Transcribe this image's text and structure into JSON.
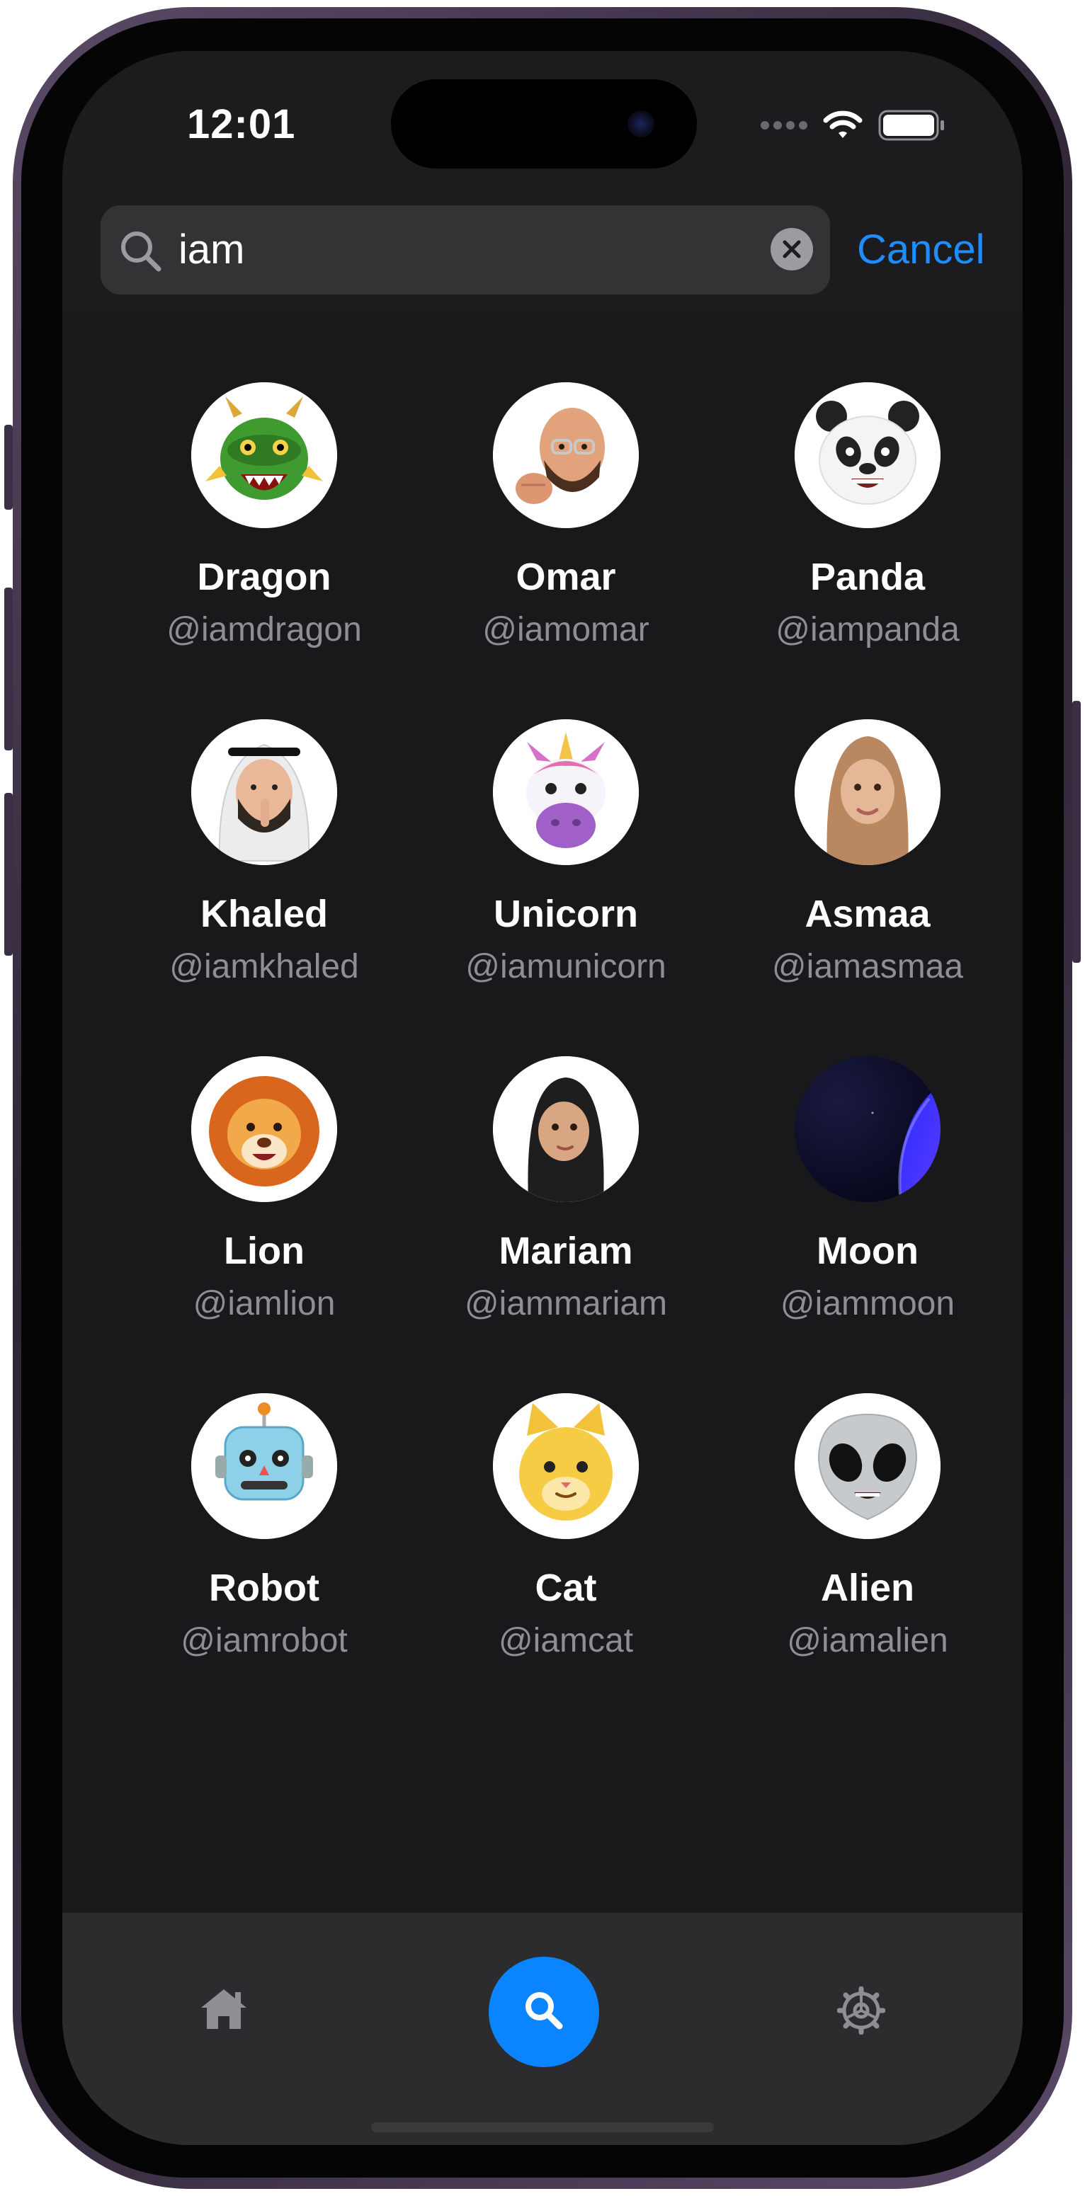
{
  "status_bar": {
    "time": "12:01"
  },
  "search": {
    "query": "iam",
    "cancel_label": "Cancel"
  },
  "results": [
    {
      "name": "Dragon",
      "handle": "@iamdragon",
      "avatar_icon": "dragon-icon"
    },
    {
      "name": "Omar",
      "handle": "@iamomar",
      "avatar_icon": "bald-man-icon"
    },
    {
      "name": "Panda",
      "handle": "@iampanda",
      "avatar_icon": "panda-icon"
    },
    {
      "name": "Khaled",
      "handle": "@iamkhaled",
      "avatar_icon": "man-keffiyeh-icon"
    },
    {
      "name": "Unicorn",
      "handle": "@iamunicorn",
      "avatar_icon": "unicorn-icon"
    },
    {
      "name": "Asmaa",
      "handle": "@iamasmaa",
      "avatar_icon": "woman-hijab-icon"
    },
    {
      "name": "Lion",
      "handle": "@iamlion",
      "avatar_icon": "lion-icon"
    },
    {
      "name": "Mariam",
      "handle": "@iammariam",
      "avatar_icon": "girl-hijab-icon"
    },
    {
      "name": "Moon",
      "handle": "@iammoon",
      "avatar_icon": "moon-planet-icon"
    },
    {
      "name": "Robot",
      "handle": "@iamrobot",
      "avatar_icon": "robot-icon"
    },
    {
      "name": "Cat",
      "handle": "@iamcat",
      "avatar_icon": "cat-icon"
    },
    {
      "name": "Alien",
      "handle": "@iamalien",
      "avatar_icon": "alien-icon"
    }
  ],
  "tab_bar": {
    "tabs": [
      {
        "icon": "home-icon",
        "active": false
      },
      {
        "icon": "search-icon",
        "active": true
      },
      {
        "icon": "settings-icon",
        "active": false
      }
    ]
  },
  "colors": {
    "accent": "#0a84ff",
    "cancel_text": "#1f8cff",
    "background": "#1c1c1e",
    "handle_text": "#8e8e93"
  }
}
